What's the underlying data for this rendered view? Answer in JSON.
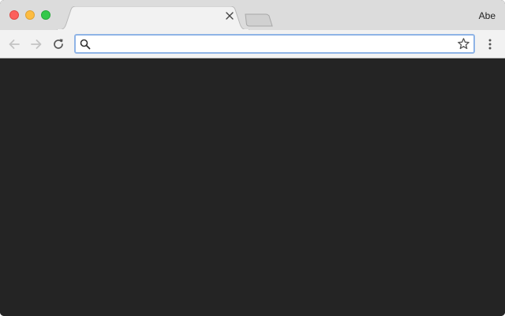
{
  "window": {
    "traffic_lights": [
      "close",
      "minimize",
      "maximize"
    ]
  },
  "tabs": [
    {
      "title": "",
      "close_icon": "close-icon",
      "active": true
    }
  ],
  "new_tab_icon": "new-tab-icon",
  "profile": {
    "name": "Abe"
  },
  "toolbar": {
    "back_icon": "arrow-left-icon",
    "forward_icon": "arrow-right-icon",
    "reload_icon": "reload-icon",
    "menu_icon": "more-vertical-icon"
  },
  "omnibox": {
    "value": "",
    "placeholder": "",
    "search_icon": "search-icon",
    "bookmark_icon": "star-icon"
  },
  "colors": {
    "tabstrip": "#dcdcdc",
    "toolbar": "#f2f2f2",
    "omnibox_focus_border": "#8fb4e6",
    "content_background": "#242424"
  }
}
